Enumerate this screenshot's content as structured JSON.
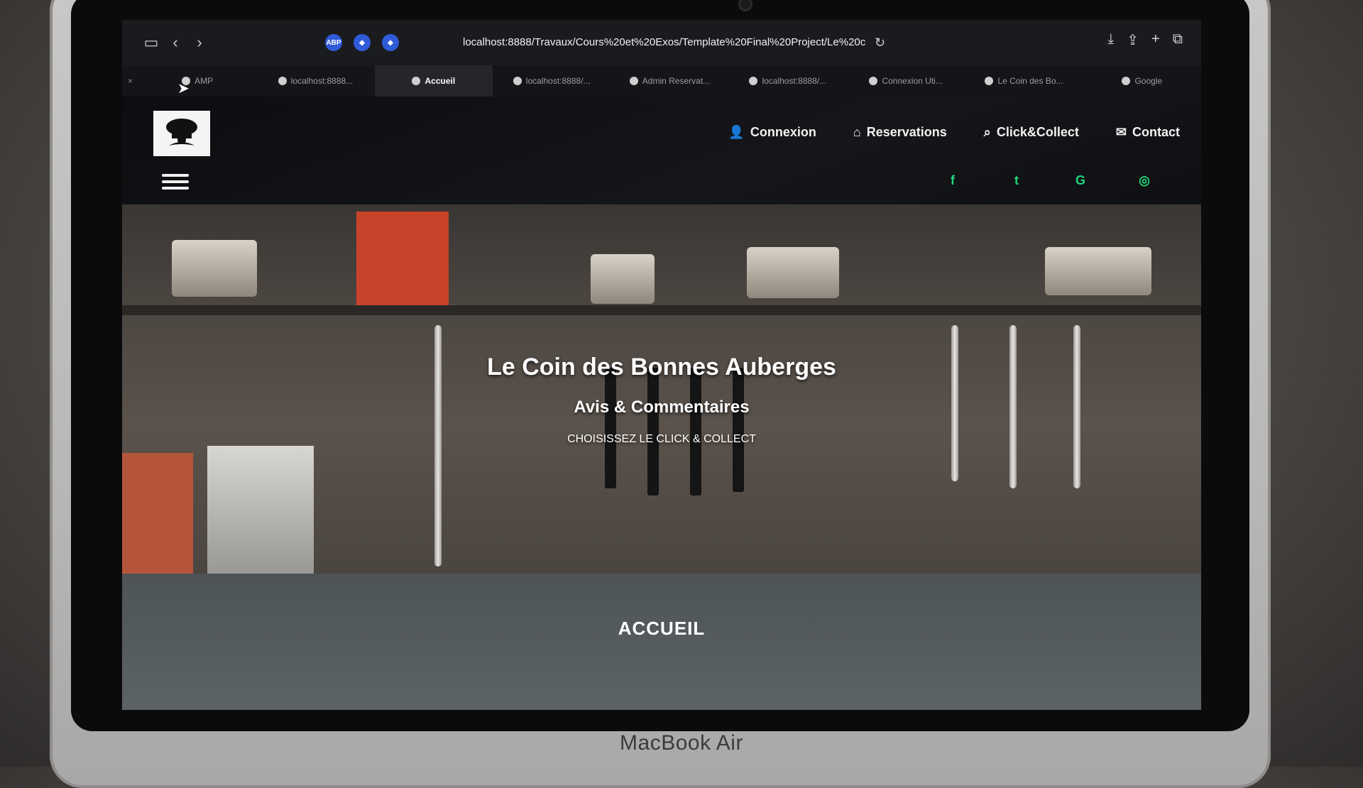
{
  "device": {
    "label": "MacBook Air"
  },
  "browser": {
    "url": "localhost:8888/Travaux/Cours%20et%20Exos/Template%20Final%20Project/Le%20c",
    "tabs": [
      {
        "label": "AMP",
        "active": false
      },
      {
        "label": "localhost:8888...",
        "active": false
      },
      {
        "label": "Accueil",
        "active": true
      },
      {
        "label": "localhost:8888/...",
        "active": false
      },
      {
        "label": "Admin Reservat...",
        "active": false
      },
      {
        "label": "localhost:8888/...",
        "active": false
      },
      {
        "label": "Connexion Uti...",
        "active": false
      },
      {
        "label": "Le Coin des Bo...",
        "active": false
      },
      {
        "label": "Google",
        "active": false
      }
    ]
  },
  "site": {
    "nav": [
      {
        "label": "Connexion",
        "icon": "user-icon"
      },
      {
        "label": "Reservations",
        "icon": "home-icon"
      },
      {
        "label": "Click&Collect",
        "icon": "search-icon"
      },
      {
        "label": "Contact",
        "icon": "envelope-icon"
      }
    ],
    "social": [
      "facebook-icon",
      "twitter-icon",
      "google-icon",
      "instagram-icon"
    ],
    "social_color": "#22d47a",
    "hero": {
      "title": "Le Coin des Bonnes Auberges",
      "subtitle": "Avis & Commentaires",
      "cta": "CHOISISSEZ LE CLICK & COLLECT"
    },
    "section_title": "ACCUEIL"
  }
}
